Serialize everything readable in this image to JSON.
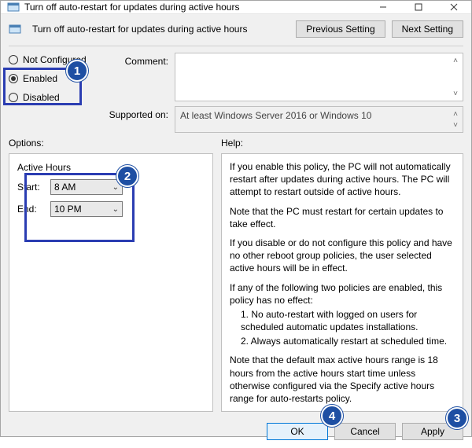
{
  "title": "Turn off auto-restart for updates during active hours",
  "subtitle": "Turn off auto-restart for updates during active hours",
  "nav": {
    "prev": "Previous Setting",
    "next": "Next Setting"
  },
  "radios": {
    "not_configured": "Not Configured",
    "enabled": "Enabled",
    "disabled": "Disabled"
  },
  "labels": {
    "comment": "Comment:",
    "supported": "Supported on:",
    "options": "Options:",
    "help": "Help:"
  },
  "supported_text": "At least Windows Server 2016 or Windows 10",
  "active_hours": {
    "title": "Active Hours",
    "start_label": "Start:",
    "end_label": "End:",
    "start_value": "8 AM",
    "end_value": "10 PM"
  },
  "help": {
    "p1": "If you enable this policy, the PC will not automatically restart after updates during active hours. The PC will attempt to restart outside of active hours.",
    "p2": "Note that the PC must restart for certain updates to take effect.",
    "p3": "If you disable or do not configure this policy and have no other reboot group policies, the user selected active hours will be in effect.",
    "p4": "If any of the following two policies are enabled, this policy has no effect:",
    "li1": "1. No auto-restart with logged on users for scheduled automatic updates installations.",
    "li2": "2. Always automatically restart at scheduled time.",
    "p5": "Note that the default max active hours range is 18 hours from the active hours start time unless otherwise configured via the Specify active hours range for auto-restarts policy."
  },
  "footer": {
    "ok": "OK",
    "cancel": "Cancel",
    "apply": "Apply"
  },
  "annotations": {
    "b1": "1",
    "b2": "2",
    "b3": "3",
    "b4": "4"
  }
}
